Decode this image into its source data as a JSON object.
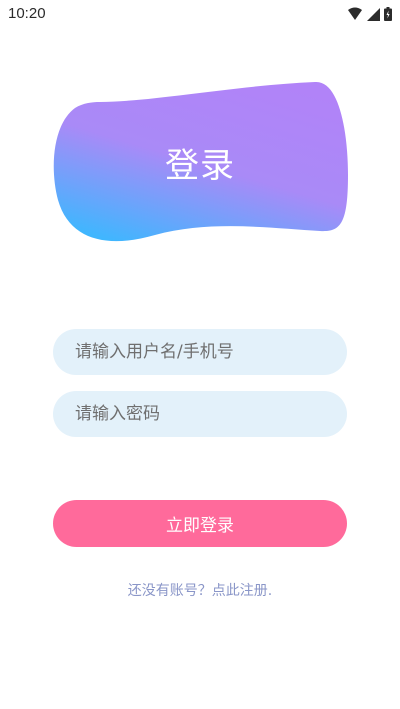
{
  "status_bar": {
    "time": "10:20",
    "icons": [
      "wifi-icon",
      "signal-icon",
      "battery-icon"
    ]
  },
  "hero": {
    "title": "登录",
    "gradient_colors": [
      "#b183f8",
      "#a98af7",
      "#40b6fe"
    ]
  },
  "form": {
    "username_placeholder": "请输入用户名/手机号",
    "password_placeholder": "请输入密码",
    "submit_label": "立即登录"
  },
  "footer": {
    "register_text": "还没有账号？点此注册."
  },
  "colors": {
    "input_background": "#e3f1fa",
    "button_background": "#ff6a9b",
    "link_color": "#8a96c8"
  }
}
